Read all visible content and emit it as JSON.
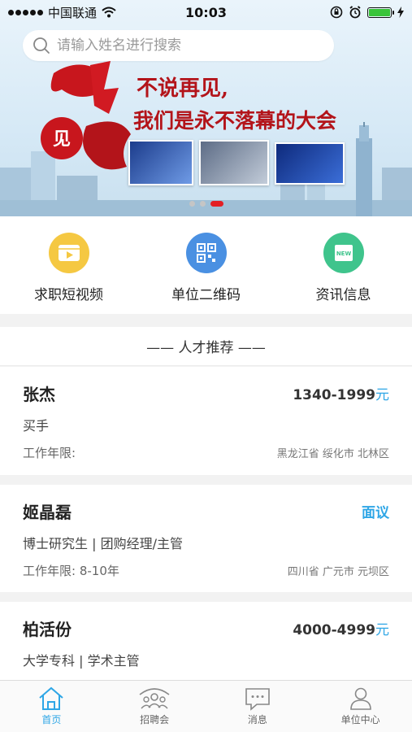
{
  "status_bar": {
    "carrier": "中国联通",
    "time": "10:03",
    "battery_percent": 100
  },
  "search": {
    "placeholder": "请输入姓名进行搜索"
  },
  "banner": {
    "calligraphy_text": "豫见您",
    "slogan_line1": "不说再见,",
    "slogan_line2": "我们是永不落幕的大会",
    "page_count": 3,
    "active_index": 2,
    "accent_color": "#b3141a"
  },
  "quick_menu": [
    {
      "label": "求职短视频",
      "icon": "video-play-icon",
      "color": "#f5c842"
    },
    {
      "label": "单位二维码",
      "icon": "qrcode-icon",
      "color": "#4a90e2"
    },
    {
      "label": "资讯信息",
      "icon": "news-icon",
      "color": "#3fc48c"
    }
  ],
  "section": {
    "title": "—— 人才推荐 ——"
  },
  "talents": [
    {
      "name": "张杰",
      "salary": "1340-1999",
      "salary_unit": "元",
      "job": "买手",
      "experience": "工作年限:",
      "location": "黑龙江省 绥化市 北林区"
    },
    {
      "name": "姬晶磊",
      "salary_negotiable": "面议",
      "job": "博士研究生 | 团购经理/主管",
      "experience": "工作年限: 8-10年",
      "location": "四川省 广元市 元坝区"
    },
    {
      "name": "柏活份",
      "salary": "4000-4999",
      "salary_unit": "元",
      "job": "大学专科 | 学术主管",
      "experience": "",
      "location": ""
    }
  ],
  "tab_bar": {
    "tabs": [
      {
        "label": "首页",
        "icon": "home-icon",
        "active": true
      },
      {
        "label": "招聘会",
        "icon": "job-fair-icon",
        "active": false
      },
      {
        "label": "消息",
        "icon": "message-icon",
        "active": false
      },
      {
        "label": "单位中心",
        "icon": "user-icon",
        "active": false
      }
    ],
    "active_color": "#2ea6e6"
  }
}
